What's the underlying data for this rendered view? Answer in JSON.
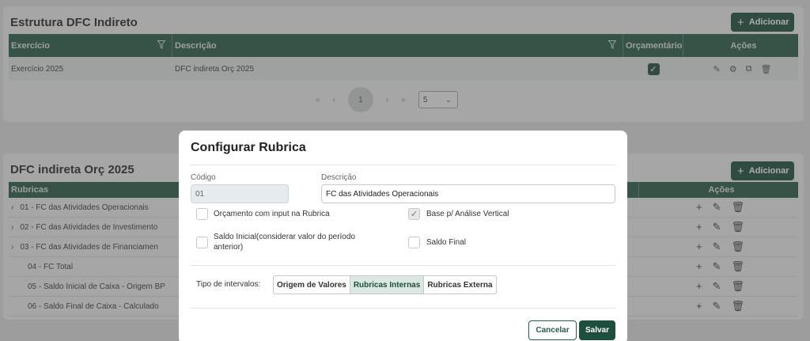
{
  "panel1": {
    "title": "Estrutura DFC Indireto",
    "add_label": "Adicionar",
    "headers": {
      "exercicio": "Exercício",
      "descricao": "Descrição",
      "orcamentario": "Orçamentário",
      "acoes": "Ações"
    },
    "row": {
      "exercicio": "Exercício 2025",
      "descricao": "DFC indireta Orç 2025",
      "orcamentario": true
    },
    "pager": {
      "first": "«",
      "prev": "‹",
      "current": "1",
      "next": "›",
      "last": "»",
      "page_size": "5"
    }
  },
  "panel2": {
    "title": "DFC indireta Orç 2025",
    "add_label": "Adicionar",
    "headers": {
      "rubricas": "Rubricas",
      "acoes": "Ações"
    },
    "rows": [
      {
        "label": "01 - FC das Atividades Operacionais",
        "expandable": true
      },
      {
        "label": "02 - FC das Atividades de Investimento",
        "expandable": true
      },
      {
        "label": "03 - FC das Atividades de Financiamen",
        "expandable": true
      },
      {
        "label": "04 - FC Total",
        "expandable": false
      },
      {
        "label": "05 - Saldo Inicial de Caixa - Origem BP",
        "expandable": false
      },
      {
        "label": "06 - Saldo Final de Caixa - Calculado",
        "expandable": false
      }
    ]
  },
  "modal": {
    "title": "Configurar Rubrica",
    "codigo_label": "Código",
    "codigo_value": "01",
    "descricao_label": "Descrição",
    "descricao_value": "FC das Atividades Operacionais",
    "checkboxes": {
      "orcamento_input": {
        "label": "Orçamento com input na Rubrica",
        "checked": false
      },
      "base_analise": {
        "label": "Base p/ Análise Vertical",
        "checked": true
      },
      "saldo_inicial": {
        "label": "Saldo Inicial(considerar valor do período anterior)",
        "checked": false
      },
      "saldo_final": {
        "label": "Saldo Final",
        "checked": false
      }
    },
    "intervalos_label": "Tipo de intervalos:",
    "intervalos_options": [
      "Origem de Valores",
      "Rubricas Internas",
      "Rubricas Externa"
    ],
    "intervalos_selected": "Rubricas Internas",
    "cancel_label": "Cancelar",
    "save_label": "Salvar"
  },
  "colors": {
    "primary": "#1e4f3e",
    "header": "#2a5b48"
  },
  "icons": {
    "filter": "filter-icon",
    "edit": "pencil-icon",
    "settings": "gear-icon",
    "copy": "copy-icon",
    "delete": "trash-icon",
    "add": "plus-icon",
    "check": "check-icon",
    "expand": "chevron-right-icon"
  }
}
